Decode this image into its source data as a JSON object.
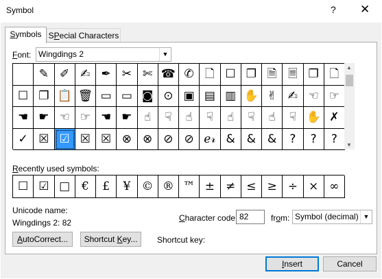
{
  "window": {
    "title": "Symbol",
    "help_glyph": "?",
    "close_glyph": "✕"
  },
  "tabs": [
    {
      "label": "Symbols",
      "underline": "S",
      "rest": "ymbols",
      "active": true
    },
    {
      "label": "Special Characters",
      "underline": "P",
      "prefix": "S",
      "rest": "ecial Characters",
      "active": false
    }
  ],
  "font": {
    "label": "Font:",
    "label_ul": "F",
    "label_rest": "ont:",
    "value": "Wingdings 2"
  },
  "symbol_grid": [
    [
      "",
      "✎",
      "✐",
      "✍",
      "✒",
      "✂",
      "✄",
      "☎",
      "✆",
      "🗋",
      "☐",
      "❐",
      "🗎",
      "🗏",
      "❐",
      "🗋"
    ],
    [
      "☐",
      "❐",
      "📋",
      "🗑",
      "▭",
      "▭",
      "◙",
      "⊙",
      "▣",
      "▤",
      "▥",
      "✋",
      "✌",
      "✍",
      "☜",
      "☞"
    ],
    [
      "☚",
      "☛",
      "☜",
      "☞",
      "☚",
      "☛",
      "☝",
      "☟",
      "☝",
      "☟",
      "☝",
      "☟",
      "☝",
      "☟",
      "✋",
      "✗"
    ],
    [
      "✓",
      "☒",
      "☑",
      "☒",
      "☒",
      "⊗",
      "⊗",
      "⊘",
      "⊘",
      "ℯ𝓇",
      "&",
      "&",
      "&",
      "?",
      "?",
      "?"
    ]
  ],
  "selected_cell": {
    "row": 3,
    "col": 2
  },
  "recent": {
    "label": "Recently used symbols:",
    "label_ul": "R",
    "label_rest": "ecently used symbols:",
    "symbols": [
      "☐",
      "☑",
      "□",
      "€",
      "£",
      "¥",
      "©",
      "®",
      "™",
      "±",
      "≠",
      "≤",
      "≥",
      "÷",
      "×",
      "∞"
    ]
  },
  "unicode": {
    "label": "Unicode name:",
    "value": "Wingdings 2: 82"
  },
  "character_code": {
    "label_ul": "C",
    "label_rest": "haracter code:",
    "value": "82"
  },
  "from": {
    "label_pre": "fr",
    "label_ul": "o",
    "label_rest": "m:",
    "value": "Symbol (decimal)"
  },
  "buttons": {
    "autocorrect": {
      "label_ul": "A",
      "label_rest": "utoCorrect..."
    },
    "shortcut_key": {
      "label_pre": "Shortcut ",
      "label_ul": "K",
      "label_rest": "ey..."
    },
    "insert": {
      "label_ul": "I",
      "label_rest": "nsert"
    },
    "cancel": {
      "label": "Cancel"
    }
  },
  "shortcut_key_label": "Shortcut key:",
  "colors": {
    "selection": "#3399ff",
    "default_button_border": "#0078d7"
  }
}
